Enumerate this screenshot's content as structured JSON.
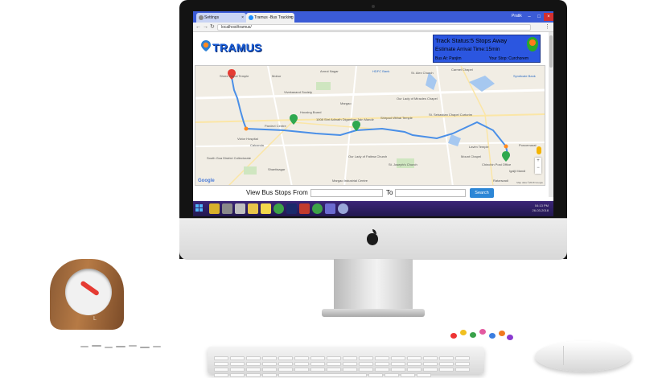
{
  "browser": {
    "tabs": [
      {
        "label": "Settings"
      },
      {
        "label": "Tramus -Bus Tracking A"
      }
    ],
    "user": "Pratik",
    "url": "localhost/tramus/"
  },
  "app": {
    "logo": "TRAMUS",
    "status": {
      "stops_away": "Track Status:5 Stops Away",
      "eta": "Estimate Arrival Time:15min",
      "bus_at": "Bus At: Panjim",
      "your_stop": "Your Stop: Curchorem"
    },
    "search": {
      "from_label": "View Bus Stops From",
      "to_label": "To",
      "from_value": "",
      "to_value": "",
      "button": "Search"
    }
  },
  "map": {
    "labels": [
      "Shree Gopal Temple",
      "Mobor",
      "Amrut Nagar",
      "HDFC Bank",
      "St. Alex Church",
      "Carmel Chapel",
      "Syndicate Bank",
      "Margao",
      "Our Lady of Miracles Chapel",
      "Vivekanand Society",
      "Housing Board",
      "1008 Shri Adinath Digamber Jain Mandir",
      "Shirpad Vitthal Temple",
      "St. Sebastian Chapel Curtorim",
      "Pardevi Centre",
      "Victor Hospital",
      "Calconda",
      "Lavim Temple",
      "Poncemarat",
      "Our Lady of Fatima Church",
      "St. Joseph's Church",
      "Mount Chapel",
      "Chinchin Post Office",
      "Shantisagar",
      "Margao Industrial Centre",
      "South Goa District Collectorate",
      "Igalji Mandi",
      "Ratanwadi"
    ],
    "attribution": "Map data ©2018 Google",
    "google": "Google",
    "zoom_in": "+",
    "zoom_out": "−"
  },
  "taskbar": {
    "time": "04:13 PM",
    "date": "26-03-2018"
  },
  "desk": {
    "clock_brand": "L"
  },
  "colors": {
    "tab_bar": "#3b5bd6",
    "status_box": "#2b56e0",
    "route": "#4a8fe7",
    "search_button": "#2c86d6",
    "taskbar": "#2b1d5e"
  },
  "icons": [
    "windows-start-icon",
    "bus-stop-marker-icon",
    "bus-icon",
    "apple-logo-icon",
    "pegman-icon"
  ]
}
